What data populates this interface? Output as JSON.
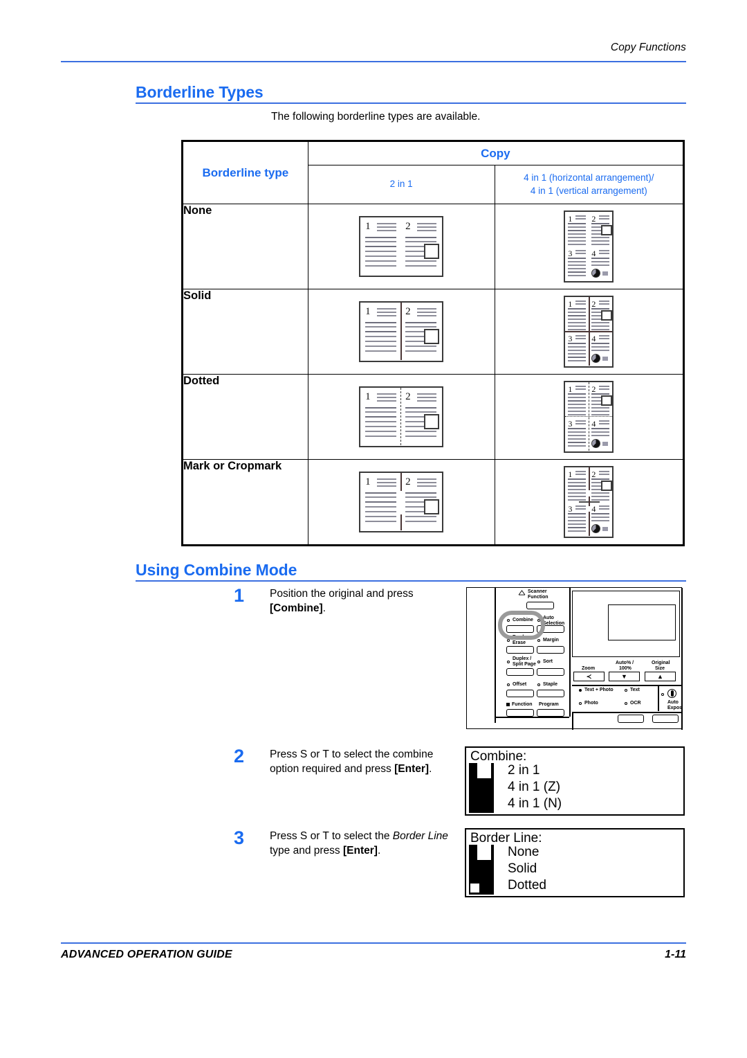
{
  "header": {
    "running_head": "Copy Functions"
  },
  "footer": {
    "guide_title": "ADVANCED OPERATION GUIDE",
    "page_number": "1-11"
  },
  "sections": {
    "borderline_types": {
      "heading": "Borderline Types",
      "intro": "The following borderline types are available."
    },
    "using_combine_mode": {
      "heading": "Using Combine Mode"
    }
  },
  "table": {
    "col_type_header": "Borderline type",
    "col_copy_header": "Copy",
    "col_2in1_header": "2 in 1",
    "col_4in1_header_line1": "4 in 1 (horizontal arrangement)/",
    "col_4in1_header_line2": "4 in 1 (vertical arrangement)",
    "rows": [
      {
        "label": "None"
      },
      {
        "label": "Solid"
      },
      {
        "label": "Dotted"
      },
      {
        "label": "Mark or Cropmark"
      }
    ],
    "page_numbers_2in1": [
      "1",
      "2"
    ],
    "page_numbers_4in1": [
      "1",
      "2",
      "3",
      "4"
    ]
  },
  "steps": [
    {
      "number": "1",
      "text_parts": [
        "Position the original and press ",
        "[Combine]",
        "."
      ]
    },
    {
      "number": "2",
      "text_parts": [
        "Press  S or  T to select the combine option required and press ",
        "[Enter]",
        "."
      ]
    },
    {
      "number": "3",
      "text_parts": [
        "Press  S or  T to select the ",
        "Border Line",
        " type and press ",
        "[Enter]",
        "."
      ]
    }
  ],
  "step1_text_a": "Position the original and press",
  "step1_text_b": "[Combine]",
  "step1_text_c": ".",
  "step2_text_a": "Press  S or  T to select the",
  "step2_text_b": "combine option required and",
  "step2_text_c": "press ",
  "step2_text_d": "[Enter]",
  "step2_text_e": ".",
  "step3_text_a": "Press  S or  T to select the ",
  "step3_text_b": "Border",
  "step3_text_c": "Line",
  "step3_text_d": " type and press ",
  "step3_text_e": "[Enter]",
  "step3_text_f": ".",
  "lcd_panels": [
    {
      "title": "Combine:",
      "options": [
        "2 in 1",
        "4 in 1 (Z)",
        "4 in 1 (N)"
      ]
    },
    {
      "title": "Border Line:",
      "options": [
        "None",
        "Solid",
        "Dotted"
      ]
    }
  ],
  "control_panel": {
    "buttons": [
      {
        "label": "Scanner Function",
        "line1": "Scanner",
        "line2": "Function"
      },
      {
        "label": "Combine",
        "line1": "Combine"
      },
      {
        "label": "Auto Selection",
        "line1": "Auto",
        "line2": "Selection"
      },
      {
        "label": "Border Erase",
        "line1": "Border",
        "line2": "Erase"
      },
      {
        "label": "Margin",
        "line1": "Margin"
      },
      {
        "label": "Duplex / Split Page",
        "line1": "Duplex /",
        "line2": "Split Page"
      },
      {
        "label": "Sort",
        "line1": "Sort"
      },
      {
        "label": "Offset",
        "line1": "Offset"
      },
      {
        "label": "Staple",
        "line1": "Staple"
      },
      {
        "label": "Function",
        "line1": "Function"
      },
      {
        "label": "Program",
        "line1": "Program"
      },
      {
        "label": "Zoom",
        "line1": "Zoom"
      },
      {
        "label": "Auto% / 100%",
        "line1": "Auto% /",
        "line2": "100%"
      },
      {
        "label": "Original Size",
        "line1": "Original",
        "line2": "Size"
      },
      {
        "label": "Text + Photo",
        "line1": "Text + Photo"
      },
      {
        "label": "Text",
        "line1": "Text"
      },
      {
        "label": "Photo",
        "line1": "Photo"
      },
      {
        "label": "OCR",
        "line1": "OCR"
      },
      {
        "label": "Auto Exposure",
        "line1": "Auto",
        "line2": "Expos"
      }
    ],
    "arrow_zoom": "≺",
    "arrow_down": "▼",
    "arrow_up": "▲",
    "highlighted_button": "Combine"
  },
  "colors": {
    "accent_blue": "#1a6bf0",
    "rule_blue": "#3b6fe0",
    "text_black": "#000000",
    "illustration_gray": "#8d8d99"
  }
}
